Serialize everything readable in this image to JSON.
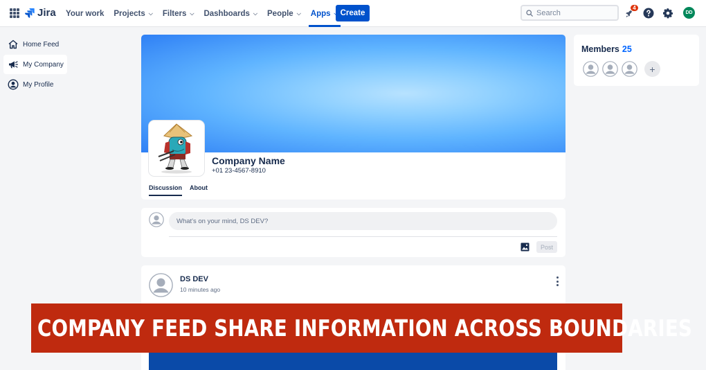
{
  "app": {
    "name": "Jira"
  },
  "nav": {
    "items": [
      {
        "label": "Your work",
        "has_menu": false
      },
      {
        "label": "Projects",
        "has_menu": true
      },
      {
        "label": "Filters",
        "has_menu": true
      },
      {
        "label": "Dashboards",
        "has_menu": true
      },
      {
        "label": "People",
        "has_menu": true
      },
      {
        "label": "Apps",
        "has_menu": true,
        "active": true
      }
    ],
    "create_label": "Create",
    "search_placeholder": "Search",
    "notification_count": "4",
    "user_initials": "DD"
  },
  "sidebar": {
    "items": [
      {
        "label": "Home Feed",
        "icon": "home-icon"
      },
      {
        "label": "My Company",
        "icon": "megaphone-icon",
        "active": true
      },
      {
        "label": "My Profile",
        "icon": "user-circle-icon"
      }
    ]
  },
  "company": {
    "name": "Company Name",
    "phone": "+01 23-4567-8910",
    "tabs": [
      {
        "label": "Discussion",
        "active": true
      },
      {
        "label": "About"
      }
    ]
  },
  "composer": {
    "placeholder": "What's on your mind, DS DEV?",
    "post_label": "Post"
  },
  "post": {
    "author": "DS DEV",
    "time": "10 minutes ago"
  },
  "members": {
    "title": "Members",
    "count": "25",
    "add_label": "+"
  },
  "banner": {
    "text": "COMPANY FEED SHARE INFORMATION ACROSS BOUNDARIES"
  },
  "colors": {
    "primary": "#0052cc",
    "banner": "#bf2a0f",
    "badge": "#de350b",
    "avatar": "#00875a"
  }
}
